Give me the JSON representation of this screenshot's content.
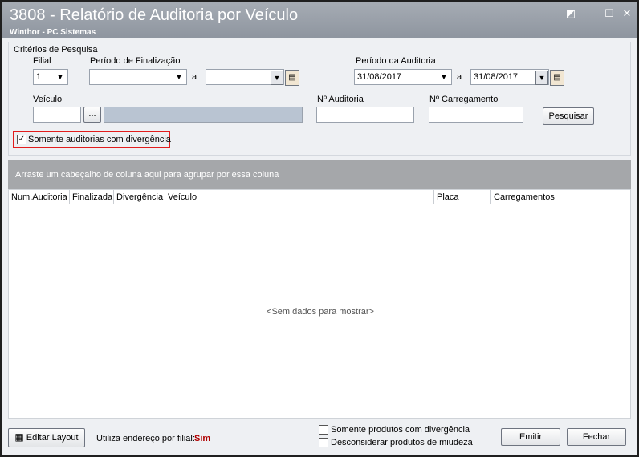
{
  "window": {
    "title": "3808 - Relatório de Auditoria por Veículo",
    "subtitle": "Winthor - PC Sistemas"
  },
  "criteria": {
    "section_label": "Critérios de Pesquisa",
    "filial_label": "Filial",
    "filial_value": "1",
    "periodo_finalizacao_label": "Período de Finalização",
    "periodo_finalizacao_inicio": "",
    "periodo_finalizacao_fim": "",
    "a_label": "a",
    "periodo_auditoria_label": "Período da Auditoria",
    "periodo_auditoria_inicio": "31/08/2017",
    "periodo_auditoria_fim": "31/08/2017",
    "veiculo_label": "Veículo",
    "veiculo_value": "",
    "veiculo_browse": "...",
    "num_auditoria_label": "Nº Auditoria",
    "num_carregamento_label": "Nº Carregamento",
    "pesquisar_label": "Pesquisar",
    "somente_divergencia_label": "Somente auditorias com divergência",
    "somente_divergencia_checked": true
  },
  "grid": {
    "group_hint": "Arraste um cabeçalho de coluna aqui para agrupar por essa coluna",
    "columns": [
      "Num.Auditoria",
      "Finalizada",
      "Divergência",
      "Veículo",
      "Placa",
      "Carregamentos"
    ],
    "empty_text": "<Sem dados para mostrar>"
  },
  "footer": {
    "editar_layout_label": "Editar Layout",
    "endereco_label": "Utiliza endereço por filial:",
    "endereco_value": "Sim",
    "produtos_divergencia_label": "Somente produtos com divergência",
    "produtos_miudeza_label": "Desconsiderar produtos de miudeza",
    "emitir_label": "Emitir",
    "fechar_label": "Fechar"
  },
  "colors": {
    "accent_red": "#e21d1d",
    "value_red": "#b00000"
  },
  "icons": [
    "restore-icon",
    "minimize-icon",
    "maximize-icon",
    "close-icon",
    "calendar-icon",
    "layout-icon",
    "chevron-down-icon"
  ]
}
